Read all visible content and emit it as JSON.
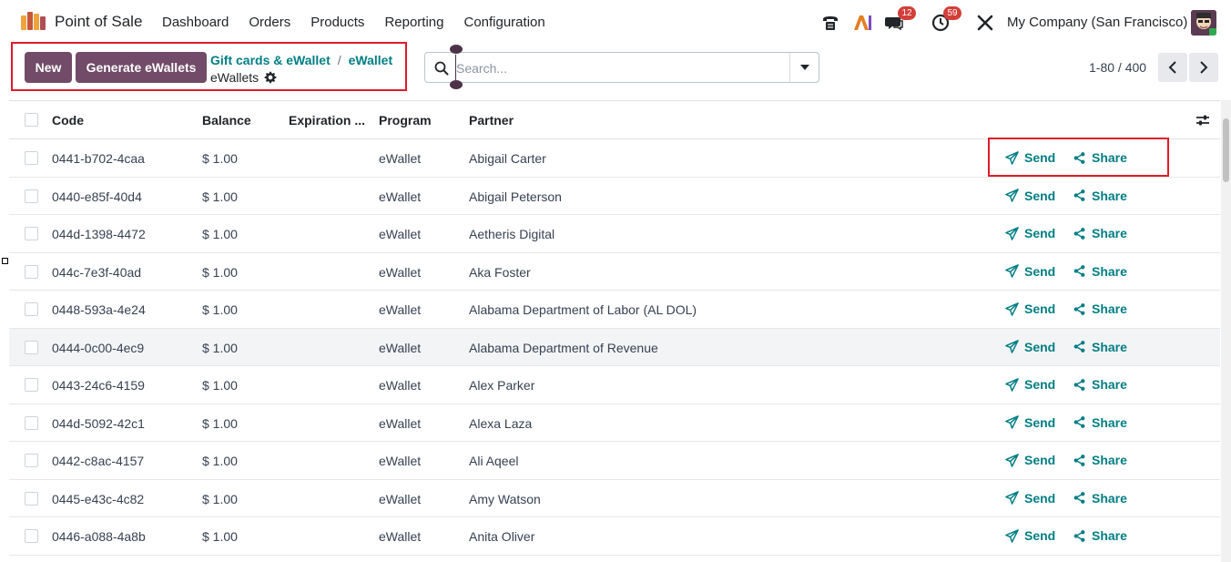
{
  "navbar": {
    "app_name": "Point of Sale",
    "menu": [
      "Dashboard",
      "Orders",
      "Products",
      "Reporting",
      "Configuration"
    ],
    "messages_count": "12",
    "activities_count": "59",
    "company": "My Company (San Francisco)"
  },
  "control": {
    "new_label": "New",
    "generate_label": "Generate eWallets",
    "breadcrumb_1": "Gift cards & eWallet",
    "breadcrumb_2": "eWallet",
    "current": "eWallets",
    "search_placeholder": "Search...",
    "pager": "1-80 / 400"
  },
  "table": {
    "headers": [
      "Code",
      "Balance",
      "Expiration ...",
      "Program",
      "Partner"
    ],
    "send_label": "Send",
    "share_label": "Share",
    "rows": [
      {
        "code": "0441-b702-4caa",
        "balance": "$ 1.00",
        "expiration": "",
        "program": "eWallet",
        "partner": "Abigail Carter"
      },
      {
        "code": "0440-e85f-40d4",
        "balance": "$ 1.00",
        "expiration": "",
        "program": "eWallet",
        "partner": "Abigail Peterson"
      },
      {
        "code": "044d-1398-4472",
        "balance": "$ 1.00",
        "expiration": "",
        "program": "eWallet",
        "partner": "Aetheris Digital"
      },
      {
        "code": "044c-7e3f-40ad",
        "balance": "$ 1.00",
        "expiration": "",
        "program": "eWallet",
        "partner": "Aka Foster"
      },
      {
        "code": "0448-593a-4e24",
        "balance": "$ 1.00",
        "expiration": "",
        "program": "eWallet",
        "partner": "Alabama Department of Labor (AL DOL)"
      },
      {
        "code": "0444-0c00-4ec9",
        "balance": "$ 1.00",
        "expiration": "",
        "program": "eWallet",
        "partner": "Alabama Department of Revenue"
      },
      {
        "code": "0443-24c6-4159",
        "balance": "$ 1.00",
        "expiration": "",
        "program": "eWallet",
        "partner": "Alex Parker"
      },
      {
        "code": "044d-5092-42c1",
        "balance": "$ 1.00",
        "expiration": "",
        "program": "eWallet",
        "partner": "Alexa Laza"
      },
      {
        "code": "0442-c8ac-4157",
        "balance": "$ 1.00",
        "expiration": "",
        "program": "eWallet",
        "partner": "Ali Aqeel"
      },
      {
        "code": "0445-e43c-4c82",
        "balance": "$ 1.00",
        "expiration": "",
        "program": "eWallet",
        "partner": "Amy Watson"
      },
      {
        "code": "0446-a088-4a8b",
        "balance": "$ 1.00",
        "expiration": "",
        "program": "eWallet",
        "partner": "Anita Oliver"
      }
    ]
  },
  "colors": {
    "brand": "#714b67",
    "link": "#017e84",
    "highlight": "#e0192b",
    "badge": "#d23f3a"
  }
}
